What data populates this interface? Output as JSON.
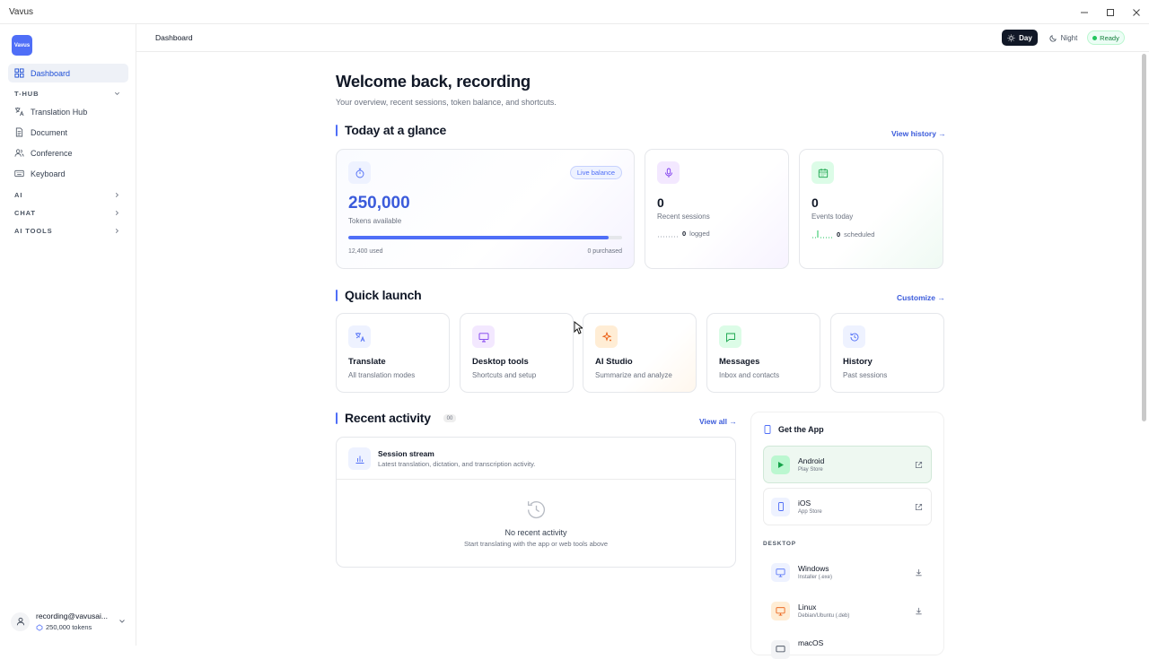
{
  "window": {
    "title": "Vavus"
  },
  "sidebar": {
    "logo_text": "Vavus",
    "items": [
      {
        "label": "Dashboard"
      },
      {
        "label": "Translation Hub"
      },
      {
        "label": "Document"
      },
      {
        "label": "Conference"
      },
      {
        "label": "Keyboard"
      }
    ],
    "sections": [
      {
        "label": "T-HUB"
      },
      {
        "label": "AI"
      },
      {
        "label": "CHAT"
      },
      {
        "label": "AI TOOLS"
      }
    ],
    "user": {
      "email": "recording@vavusai...",
      "tokens": "250,000 tokens"
    }
  },
  "header": {
    "breadcrumb": "Dashboard",
    "day_label": "Day",
    "night_label": "Night",
    "status": "Ready"
  },
  "main": {
    "title": "Welcome back, recording",
    "subtitle": "Your overview, recent sessions, token balance, and shortcuts.",
    "glance": {
      "title": "Today at a glance",
      "link": "View history →",
      "balance": {
        "badge": "Live balance",
        "value": "250,000",
        "caption": "Tokens available",
        "used": "12,400 used",
        "purchased": "0 purchased",
        "progress_fraction": 0.95
      },
      "sessions": {
        "value": "0",
        "caption": "Recent sessions",
        "foot_value": "0",
        "foot_label": "logged"
      },
      "events": {
        "value": "0",
        "caption": "Events today",
        "foot_value": "0",
        "foot_label": "scheduled"
      }
    },
    "quick_launch": {
      "title": "Quick launch",
      "link": "Customize →",
      "items": [
        {
          "title": "Translate",
          "sub": "All translation modes"
        },
        {
          "title": "Desktop tools",
          "sub": "Shortcuts and setup"
        },
        {
          "title": "AI Studio",
          "sub": "Summarize and analyze"
        },
        {
          "title": "Messages",
          "sub": "Inbox and contacts"
        },
        {
          "title": "History",
          "sub": "Past sessions"
        }
      ]
    },
    "activity": {
      "title": "Recent activity",
      "count": "00",
      "link": "View all →",
      "stream_title": "Session stream",
      "stream_sub": "Latest translation, dictation, and transcription activity.",
      "empty_title": "No recent activity",
      "empty_sub": "Start translating with the app or web tools above"
    },
    "get_app": {
      "title": "Get the App",
      "mobile": [
        {
          "name": "Android",
          "store": "Play Store"
        },
        {
          "name": "iOS",
          "store": "App Store"
        }
      ],
      "desktop_label": "DESKTOP",
      "desktop": [
        {
          "name": "Windows",
          "sub": "Installer (.exe)"
        },
        {
          "name": "Linux",
          "sub": "Debian/Ubuntu (.deb)"
        },
        {
          "name": "macOS",
          "sub": ""
        }
      ]
    }
  },
  "colors": {
    "accent": "#4f6ef7",
    "ready": "#22c55e"
  }
}
